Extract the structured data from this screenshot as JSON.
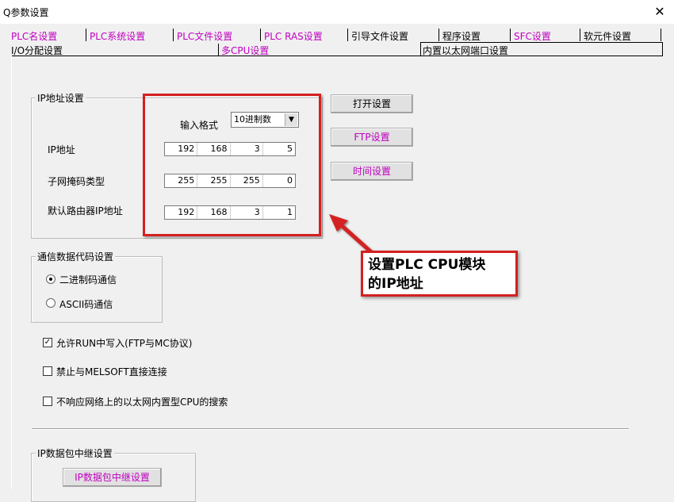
{
  "window": {
    "title": "Q参数设置",
    "close_glyph": "✕"
  },
  "tabs": {
    "row1": [
      "PLC名设置",
      "PLC系统设置",
      "PLC文件设置",
      "PLC RAS设置",
      "引导文件设置",
      "程序设置",
      "SFC设置",
      "软元件设置"
    ],
    "row2": [
      "I/O分配设置",
      "多CPU设置",
      "内置以太网端口设置"
    ]
  },
  "ip_group": {
    "legend": "IP地址设置",
    "input_format_label": "输入格式",
    "input_format_value": "10进制数",
    "ip_label": "IP地址",
    "ip": [
      "192",
      "168",
      "3",
      "5"
    ],
    "subnet_label": "子网掩码类型",
    "subnet": [
      "255",
      "255",
      "255",
      "0"
    ],
    "gateway_label": "默认路由器IP地址",
    "gateway": [
      "192",
      "168",
      "3",
      "1"
    ]
  },
  "buttons": {
    "open": "打开设置",
    "ftp": "FTP设置",
    "time": "时间设置",
    "relay": "IP数据包中继设置"
  },
  "comm_group": {
    "legend": "通信数据代码设置",
    "binary": "二进制码通信",
    "ascii": "ASCII码通信",
    "selected": "binary"
  },
  "options": {
    "allow_run_write": "允许RUN中写入(FTP与MC协议)",
    "allow_run_write_checked": true,
    "forbid_melsoft": "禁止与MELSOFT直接连接",
    "forbid_melsoft_checked": false,
    "no_search": "不响应网络上的以太网内置型CPU的搜索",
    "no_search_checked": false
  },
  "relay_group": {
    "legend": "IP数据包中继设置"
  },
  "annotation": {
    "line1": "设置PLC CPU模块",
    "line2": "的IP地址",
    "color": "#d42020"
  }
}
